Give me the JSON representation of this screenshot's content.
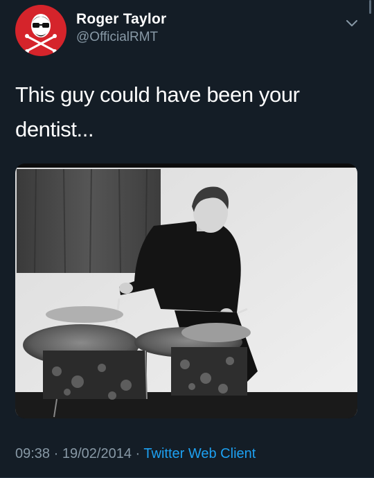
{
  "author": {
    "name": "Roger Taylor",
    "handle": "@OfficialRMT"
  },
  "tweet": {
    "text_line1": "This guy could have been your",
    "text_line2": "dentist..."
  },
  "meta": {
    "time": "09:38",
    "date": "19/02/2014",
    "separator": "·",
    "client": "Twitter Web Client"
  },
  "colors": {
    "background": "#141d26",
    "avatar": "#d5242b",
    "secondary_text": "#8899a6",
    "link": "#1da1f2"
  },
  "icons": {
    "menu": "chevron-down-icon",
    "avatar_logo": "skull-crossbones-icon"
  }
}
